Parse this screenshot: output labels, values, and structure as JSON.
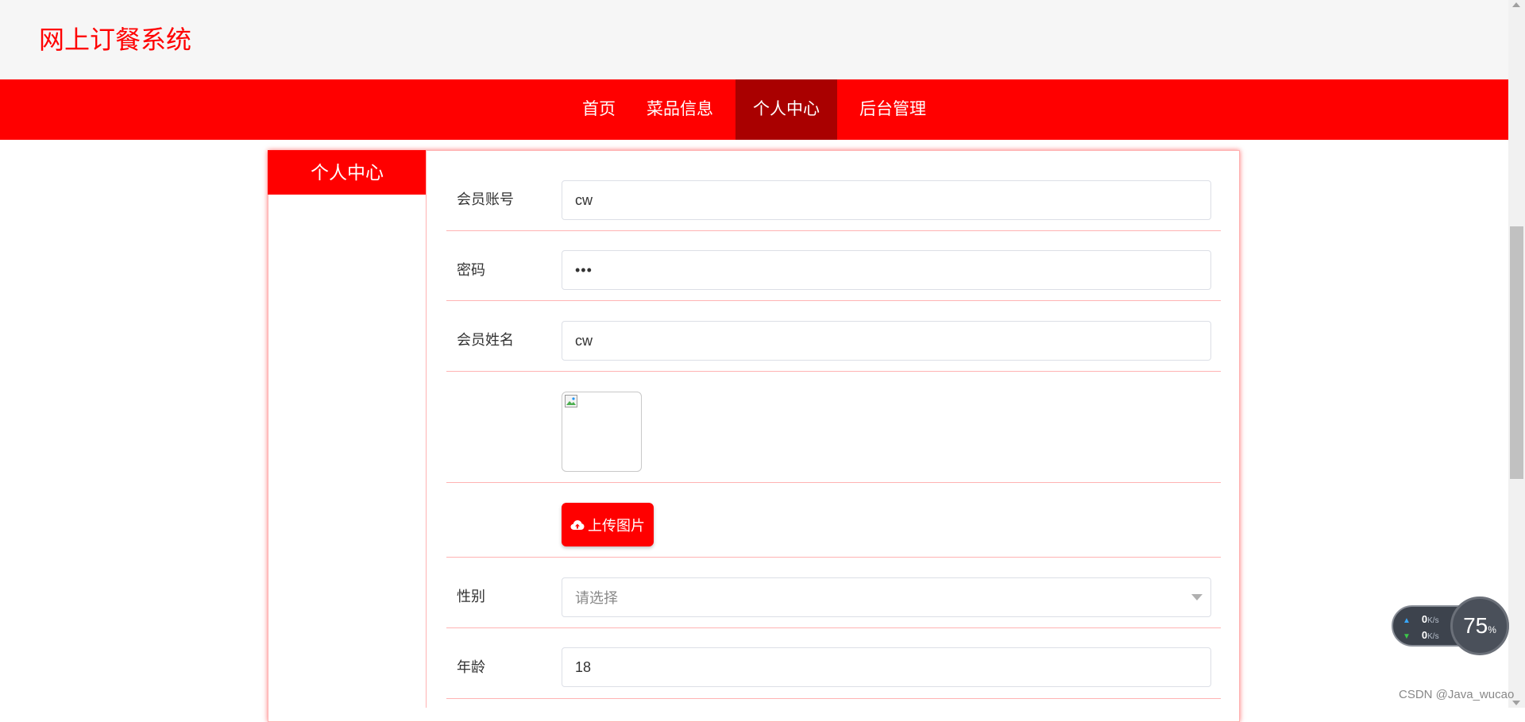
{
  "header": {
    "site_title": "网上订餐系统"
  },
  "nav": {
    "items": [
      {
        "label": "首页",
        "active": false
      },
      {
        "label": "菜品信息",
        "active": false
      },
      {
        "label": "个人中心",
        "active": true
      },
      {
        "label": "后台管理",
        "active": false
      }
    ]
  },
  "sidebar": {
    "title": "个人中心"
  },
  "form": {
    "account": {
      "label": "会员账号",
      "value": "cw"
    },
    "password": {
      "label": "密码",
      "value": "•••"
    },
    "name": {
      "label": "会员姓名",
      "value": "cw"
    },
    "upload_button": "上传图片",
    "gender": {
      "label": "性别",
      "placeholder": "请选择"
    },
    "age": {
      "label": "年龄",
      "value": "18"
    }
  },
  "net_monitor": {
    "upload_speed": "0",
    "download_speed": "0",
    "speed_unit": "K/s",
    "percent": "75",
    "percent_sign": "%"
  },
  "watermark": "CSDN @Java_wucao",
  "colors": {
    "brand": "#ff0000",
    "nav_active": "#a90000",
    "header_bg": "#f6f6f6"
  }
}
